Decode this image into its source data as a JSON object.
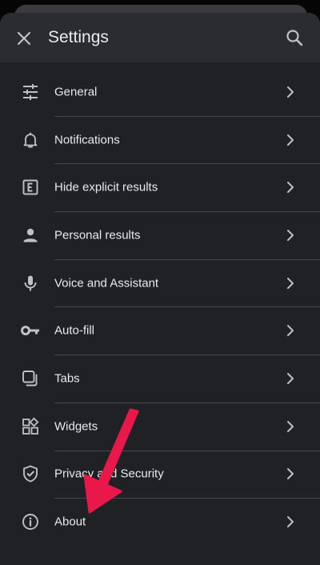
{
  "header": {
    "title": "Settings",
    "close_icon": "close-icon",
    "search_icon": "search-icon"
  },
  "items": [
    {
      "label": "General",
      "icon": "tune-icon"
    },
    {
      "label": "Notifications",
      "icon": "bell-icon"
    },
    {
      "label": "Hide explicit results",
      "icon": "explicit-icon"
    },
    {
      "label": "Personal results",
      "icon": "person-icon"
    },
    {
      "label": "Voice and Assistant",
      "icon": "microphone-icon"
    },
    {
      "label": "Auto-fill",
      "icon": "key-icon"
    },
    {
      "label": "Tabs",
      "icon": "tabs-icon"
    },
    {
      "label": "Widgets",
      "icon": "widgets-icon"
    },
    {
      "label": "Privacy and Security",
      "icon": "shield-icon"
    },
    {
      "label": "About",
      "icon": "info-icon"
    }
  ],
  "annotation": {
    "arrow_color": "#e8184a",
    "points_to": "About"
  },
  "colors": {
    "background": "#202124",
    "header": "#2b2c2f",
    "text": "#e8eaed",
    "icon": "#bdc1c6",
    "divider": "#47484c"
  }
}
